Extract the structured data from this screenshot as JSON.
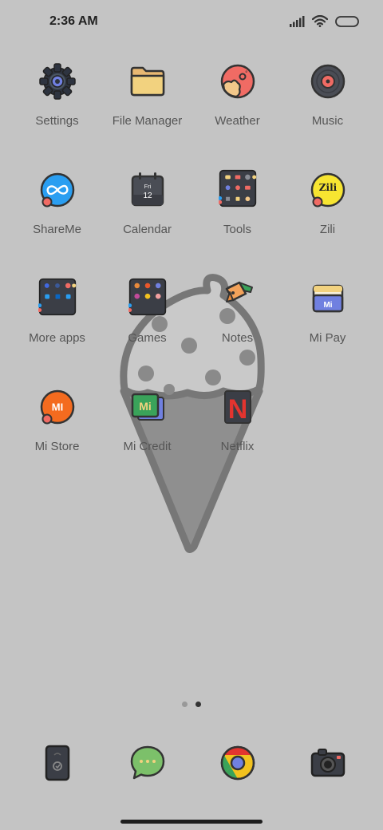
{
  "status_bar": {
    "time": "2:36 AM",
    "icons": [
      "signal-icon",
      "wifi-icon",
      "battery-icon"
    ]
  },
  "apps": [
    {
      "label": "Settings",
      "icon": "gear-icon"
    },
    {
      "label": "File Manager",
      "icon": "folder-icon"
    },
    {
      "label": "Weather",
      "icon": "weather-icon"
    },
    {
      "label": "Music",
      "icon": "vinyl-record-icon"
    },
    {
      "label": "ShareMe",
      "icon": "shareme-icon"
    },
    {
      "label": "Calendar",
      "icon": "calendar-icon",
      "day": "Fri",
      "date": "12"
    },
    {
      "label": "Tools",
      "icon": "folder-grid-icon"
    },
    {
      "label": "Zili",
      "icon": "zili-icon",
      "badge": "Zili"
    },
    {
      "label": "More apps",
      "icon": "folder-grid-icon"
    },
    {
      "label": "Games",
      "icon": "folder-grid-icon"
    },
    {
      "label": "Notes",
      "icon": "pencil-icon"
    },
    {
      "label": "Mi Pay",
      "icon": "wallet-icon"
    },
    {
      "label": "Mi Store",
      "icon": "mi-store-icon",
      "badge": "MI"
    },
    {
      "label": "Mi Credit",
      "icon": "mi-credit-icon",
      "badge": "Mi"
    },
    {
      "label": "Netflix",
      "icon": "netflix-icon",
      "badge": "N"
    }
  ],
  "page_indicator": {
    "count": 2,
    "active": 2
  },
  "dock": [
    {
      "name": "phone",
      "icon": "phone-icon"
    },
    {
      "name": "messages",
      "icon": "message-bubble-icon"
    },
    {
      "name": "browser",
      "icon": "chrome-icon"
    },
    {
      "name": "camera",
      "icon": "camera-icon"
    }
  ],
  "colors": {
    "background": "#c4c4c4",
    "icon_outline": "#333333",
    "label_text": "#555555",
    "accent_red": "#f06b64",
    "accent_yellow": "#f2d27f",
    "accent_blue": "#2a9ef1"
  }
}
